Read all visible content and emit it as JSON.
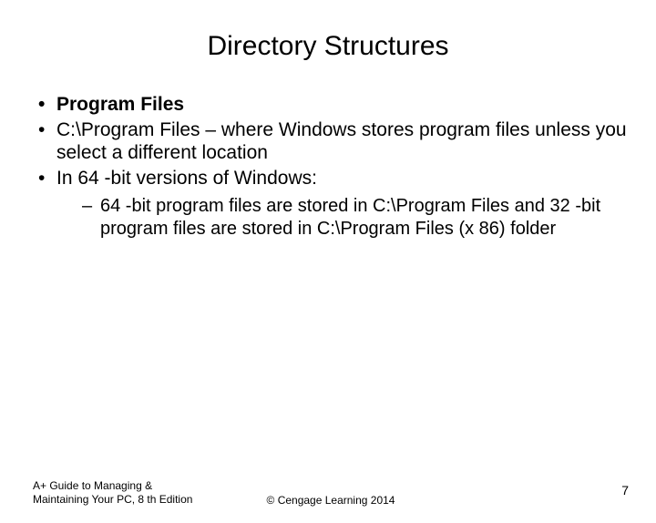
{
  "title": "Directory Structures",
  "bullets": {
    "b1": "Program Files",
    "b2": "C:\\Program Files – where Windows stores program files unless you select a different location",
    "b3": "In 64 -bit versions of Windows:",
    "sub1": "64 -bit program files are stored in C:\\Program Files and 32 -bit program files are stored in C:\\Program Files (x 86) folder"
  },
  "footer": {
    "left": "A+ Guide to Managing & Maintaining Your PC, 8 th Edition",
    "center": "© Cengage Learning  2014",
    "page": "7"
  }
}
